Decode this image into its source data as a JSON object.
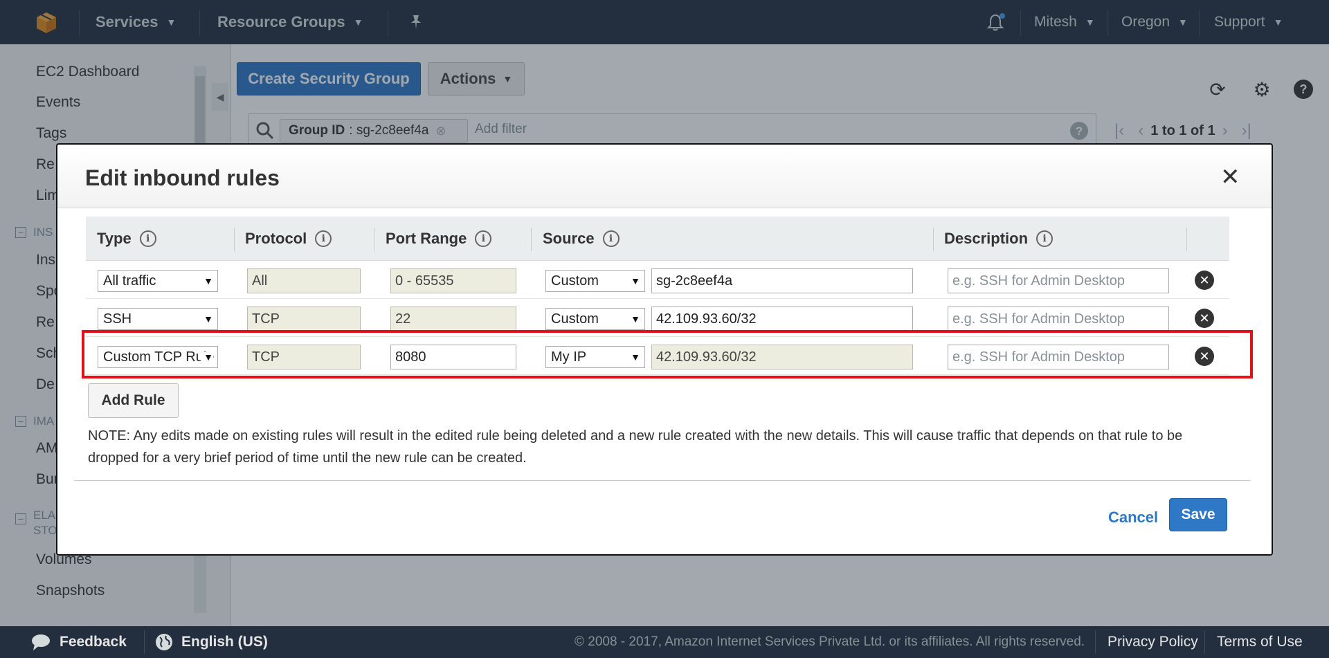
{
  "topnav": {
    "logo_icon": "aws-cube-icon",
    "services": "Services",
    "resource_groups": "Resource Groups",
    "pin_icon": "pin-icon",
    "bell_icon": "bell-icon",
    "user": "Mitesh",
    "region": "Oregon",
    "support": "Support"
  },
  "sidebar": {
    "items": [
      "EC2 Dashboard",
      "Events",
      "Tags",
      "Re",
      "Lim",
      "Ins",
      "Spo",
      "Re",
      "Sch",
      "De",
      "AM",
      "Bun",
      "Volumes",
      "Snapshots"
    ],
    "groups": [
      "INS",
      "IMA",
      "ELA",
      "STO"
    ]
  },
  "toolbar": {
    "create_security_group": "Create Security Group",
    "actions": "Actions"
  },
  "filter": {
    "chip_key": "Group ID",
    "chip_value": ": sg-2c8eef4a",
    "placeholder": "Add filter"
  },
  "pager": {
    "text": "1 to 1 of 1"
  },
  "modal": {
    "title": "Edit inbound rules",
    "columns": [
      "Type",
      "Protocol",
      "Port Range",
      "Source",
      "Description"
    ],
    "rows": [
      {
        "type": "All traffic",
        "protocol": "All",
        "port_range": "0 - 65535",
        "source_type": "Custom",
        "source": "sg-2c8eef4a",
        "description_placeholder": "e.g. SSH for Admin Desktop"
      },
      {
        "type": "SSH",
        "protocol": "TCP",
        "port_range": "22",
        "source_type": "Custom",
        "source": "42.109.93.60/32",
        "description_placeholder": "e.g. SSH for Admin Desktop"
      },
      {
        "type": "Custom TCP Rule",
        "protocol": "TCP",
        "port_range": "8080",
        "source_type": "My IP",
        "source": "42.109.93.60/32",
        "description_placeholder": "e.g. SSH for Admin Desktop"
      }
    ],
    "add_rule": "Add Rule",
    "note": "NOTE: Any edits made on existing rules will result in the edited rule being deleted and a new rule created with the new details. This will cause traffic that depends on that rule to be dropped for a very brief period of time until the new rule can be created.",
    "cancel": "Cancel",
    "save": "Save"
  },
  "footer": {
    "feedback": "Feedback",
    "language": "English (US)",
    "copyright": "© 2008 - 2017, Amazon Internet Services Private Ltd. or its affiliates. All rights reserved.",
    "privacy": "Privacy Policy",
    "terms": "Terms of Use"
  },
  "colors": {
    "nav_bg": "#232f3e",
    "primary_blue": "#2e78c5",
    "highlight_red": "#e0111b"
  }
}
